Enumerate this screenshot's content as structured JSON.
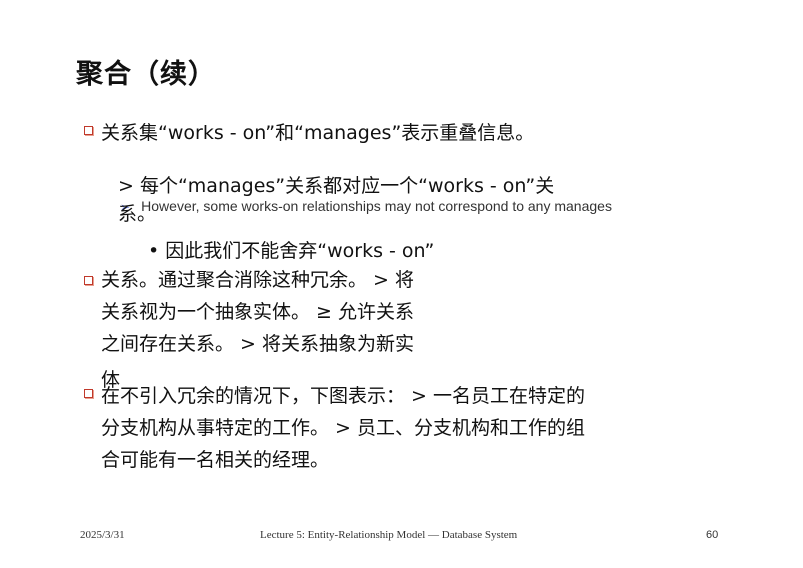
{
  "slide": {
    "title": "聚合（续）",
    "para1": "关系集“works - on”和“manages”表示重叠信息。",
    "sub1_line1": "> 每个“manages”关系都对应一个“works - on”关",
    "sub1_line2": "系。",
    "sub2": "• 因此我们不能舍弃“works - on”",
    "para2_line1": "关系。通过聚合消除这种冗余。 > 将",
    "para2_line2": "关系视为一个抽象实体。 ≥ 允许关系",
    "para2_line3": "之间存在关系。 > 将关系抽象为新实",
    "para2_line4": "体",
    "para3_line1": "在不引入冗余的情况下，下图表示： > 一名员工在特定的",
    "para3_line2": "分支机构从事特定的工作。 > 员工、分支机构和工作的组",
    "para3_line3": "合可能有一名相关的经理。",
    "ghost_text": "However, some works-on relationships may not correspond to any manages",
    "ghost_arrow": "➢"
  },
  "footer": {
    "date": "2025/3/31",
    "lecture": "Lecture 5: Entity-Relationship Model — Database System",
    "page": "60"
  },
  "colors": {
    "bullet": "#c0392b",
    "ghost_arrow": "#4a60c8"
  }
}
